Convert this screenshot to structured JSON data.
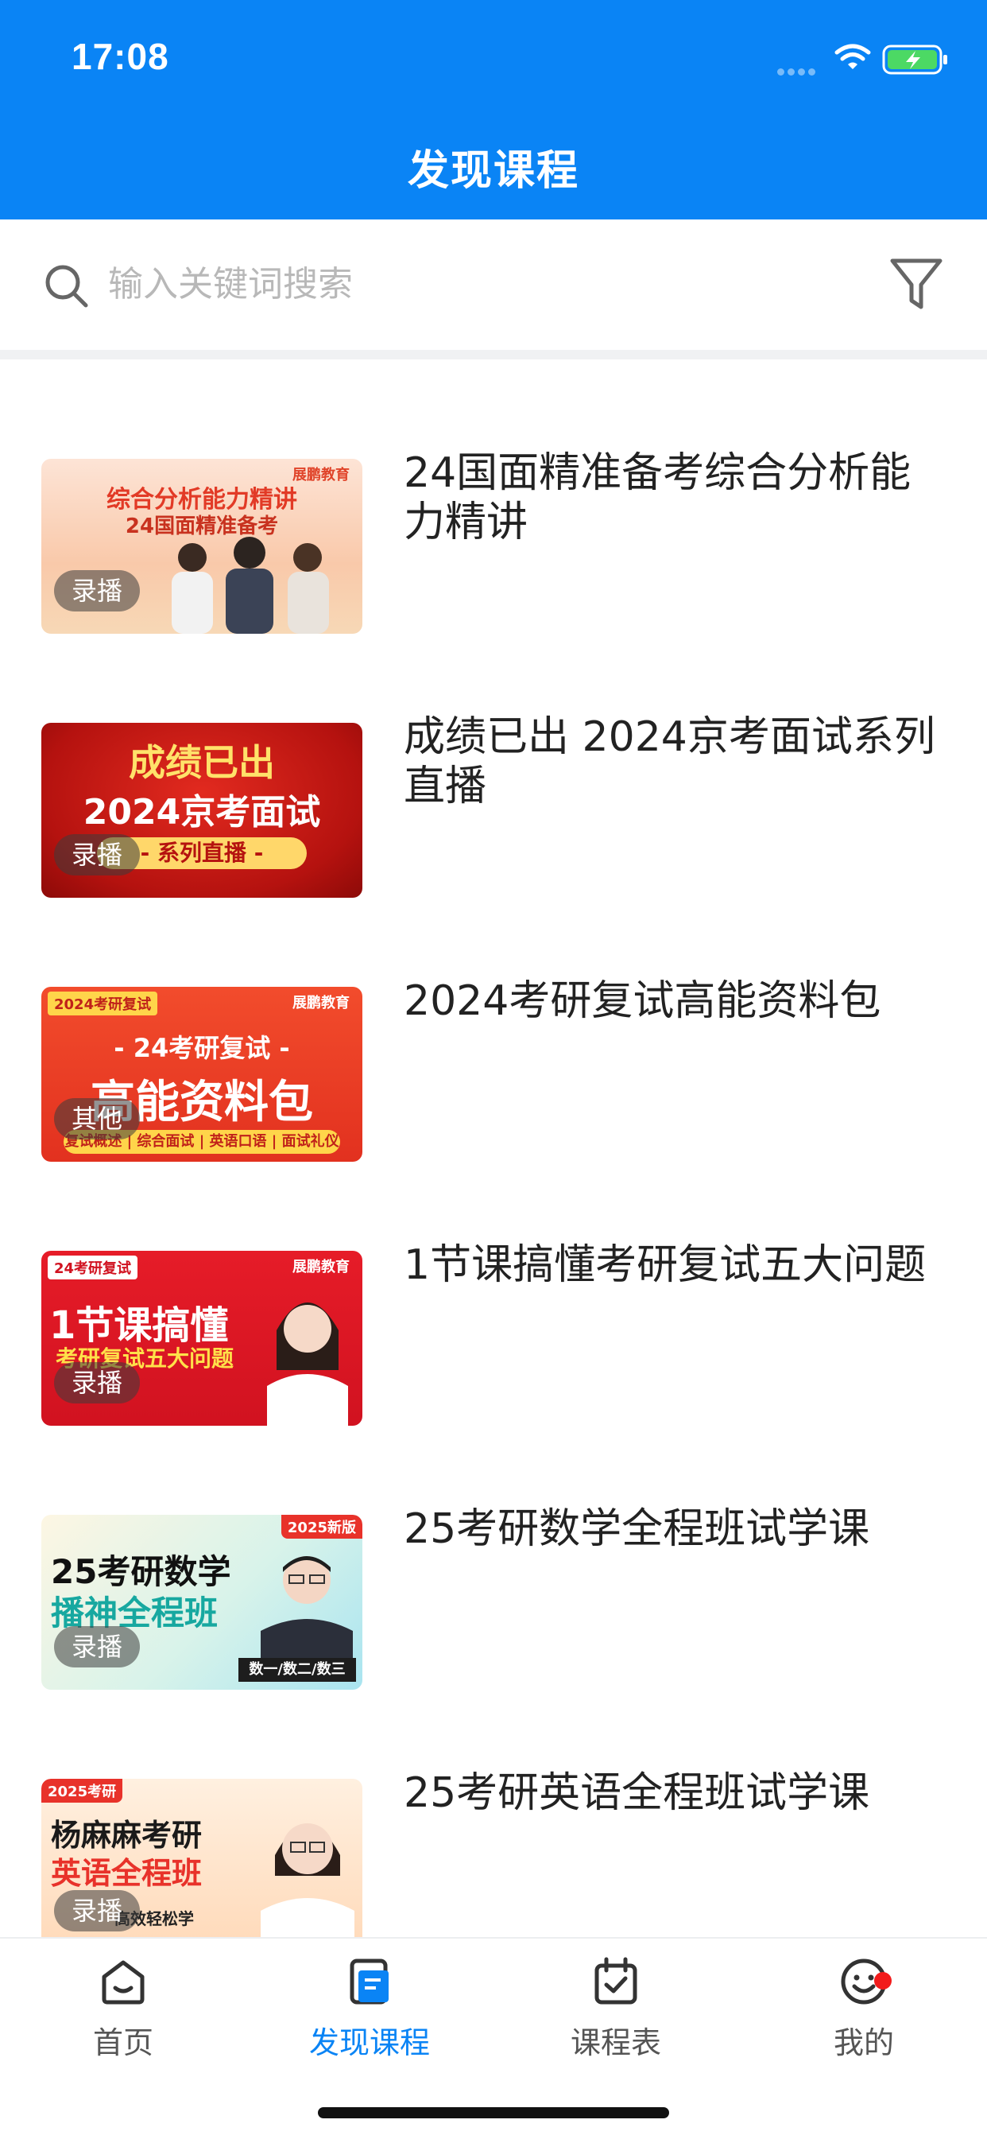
{
  "status_bar": {
    "time": "17:08"
  },
  "header": {
    "title": "发现课程"
  },
  "search": {
    "placeholder": "输入关键词搜索"
  },
  "courses": [
    {
      "title": "24国面精准备考综合分析能力精讲",
      "tag": "录播",
      "thumb_lines": [
        "综合分析能力精讲",
        "24国面精准备考"
      ],
      "logo": "展鹏教育"
    },
    {
      "title": "成绩已出 2024京考面试系列直播",
      "tag": "录播",
      "thumb_lines": [
        "成绩已出",
        "2024京考面试",
        "- 系列直播 -"
      ]
    },
    {
      "title": "2024考研复试高能资料包",
      "tag": "其他",
      "thumb_lines": [
        "- 24考研复试 -",
        "高能资料包",
        "复试概述 | 综合面试 | 英语口语 | 面试礼仪"
      ],
      "corner": "2024考研复试",
      "logo": "展鹏教育"
    },
    {
      "title": "1节课搞懂考研复试五大问题",
      "tag": "录播",
      "thumb_lines": [
        "1节课搞懂",
        "考研复试五大问题"
      ],
      "corner": "24考研复试",
      "logo": "展鹏教育"
    },
    {
      "title": "25考研数学全程班试学课",
      "tag": "录播",
      "thumb_lines": [
        "25考研数学",
        "播神全程班",
        "数一/数二/数三"
      ],
      "corner": "2025新版"
    },
    {
      "title": "25考研英语全程班试学课",
      "tag": "录播",
      "thumb_lines": [
        "杨麻麻考研",
        "英语全程班",
        "高效轻松学"
      ],
      "corner": "2025考研"
    }
  ],
  "tabbar": {
    "items": [
      {
        "label": "首页",
        "icon": "home-icon"
      },
      {
        "label": "发现课程",
        "icon": "discover-icon"
      },
      {
        "label": "课程表",
        "icon": "calendar-icon"
      },
      {
        "label": "我的",
        "icon": "profile-icon"
      }
    ]
  },
  "colors": {
    "brand": "#0a84f5",
    "badge": "#f21b1b"
  }
}
